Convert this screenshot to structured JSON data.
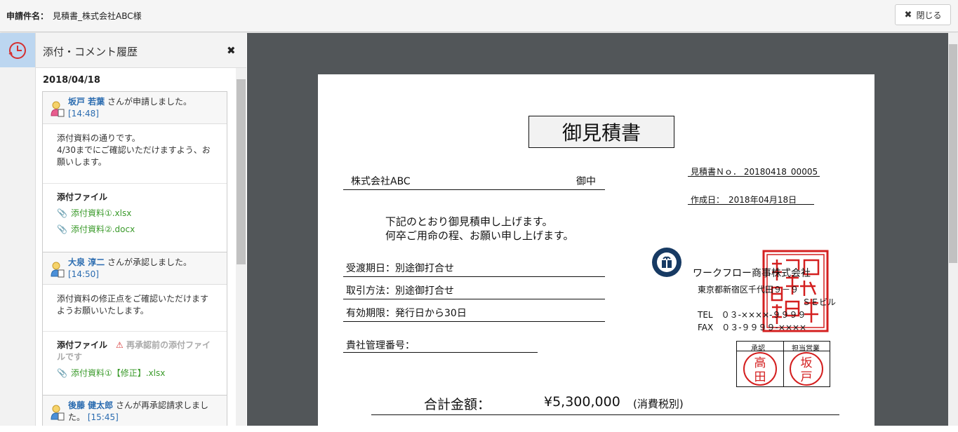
{
  "header": {
    "title_label": "申請件名：",
    "title_value": "見積書_株式会社ABC様",
    "close_label": "閉じる"
  },
  "panel": {
    "title": "添付・コメント履歴",
    "date": "2018/04/18"
  },
  "entries": [
    {
      "name": "坂戸 若葉",
      "action": "さんが申請しました。",
      "time": "[14:48]",
      "comment": "添付資料の通りです。\n4/30までにご確認いただけますよう、お願いします。",
      "files_title": "添付ファイル",
      "files": [
        "添付資料①.xlsx",
        "添付資料②.docx"
      ]
    },
    {
      "name": "大泉 淳二",
      "action": "さんが承認しました。",
      "time": "[14:50]",
      "comment": "添付資料の修正点をご確認いただけますようお願いいたします。",
      "files_title": "添付ファイル",
      "warning": "再承認前の添付ファイルです",
      "files": [
        "添付資料①【修正】.xlsx"
      ]
    },
    {
      "name": "後藤 健太郎",
      "action": "さんが再承認請求しました。",
      "time": "[15:45]"
    }
  ],
  "doc": {
    "title": "御見積書",
    "estimate_no_label": "見積書Ｎｏ．",
    "estimate_no": "20180418_00005",
    "created_label": "作成日：",
    "created": "2018年04月18日",
    "client": "株式会社ABC",
    "client_suffix": "御中",
    "greeting1": "下記のとおり御見積申し上げます。",
    "greeting2": "何卒ご用命の程、お願い申し上げます。",
    "delivery": "受渡期日：別途御打合せ",
    "payment": "取引方法：別途御打合せ",
    "validity": "有効期限：発行日から30日",
    "mgmt_no": "貴社管理番号：",
    "company": "ワークフロー商事株式会社",
    "address": "東京都新宿区千代田９－９",
    "building": "ＳＥビル",
    "tel": "TEL　０３-××××-９９９９",
    "fax": "FAX　０３-９９９９-××××",
    "approve_label": "承認",
    "sales_label": "担当営業",
    "stamp1": [
      "高",
      "田"
    ],
    "stamp2": [
      "坂",
      "戸"
    ],
    "seal": "ワークフロー商事株式会社之印",
    "total_label": "合計金額：",
    "total_value": "¥5,300,000",
    "total_note": "(消費税別)"
  },
  "colors": {
    "accent": "#2b6cb0",
    "file": "#3a9a2a",
    "stamp": "#d42020"
  }
}
